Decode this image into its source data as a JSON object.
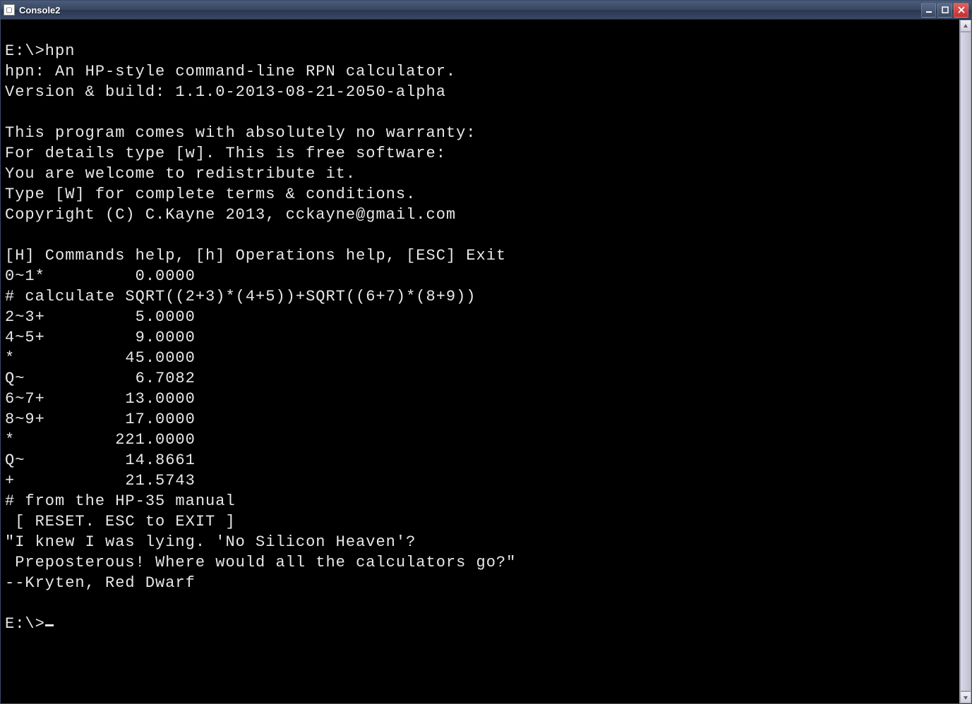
{
  "window": {
    "title": "Console2"
  },
  "terminal": {
    "lines": [
      "E:\\>hpn",
      "hpn: An HP-style command-line RPN calculator.",
      "Version & build: 1.1.0-2013-08-21-2050-alpha",
      "",
      "This program comes with absolutely no warranty:",
      "For details type [w]. This is free software:",
      "You are welcome to redistribute it.",
      "Type [W] for complete terms & conditions.",
      "Copyright (C) C.Kayne 2013, cckayne@gmail.com",
      "",
      "[H] Commands help, [h] Operations help, [ESC] Exit",
      "0~1*         0.0000",
      "# calculate SQRT((2+3)*(4+5))+SQRT((6+7)*(8+9))",
      "2~3+         5.0000",
      "4~5+         9.0000",
      "*           45.0000",
      "Q~           6.7082",
      "6~7+        13.0000",
      "8~9+        17.0000",
      "*          221.0000",
      "Q~          14.8661",
      "+           21.5743",
      "# from the HP-35 manual",
      " [ RESET. ESC to EXIT ]",
      "\"I knew I was lying. 'No Silicon Heaven'?",
      " Preposterous! Where would all the calculators go?\"",
      "--Kryten, Red Dwarf",
      "",
      "E:\\>"
    ]
  }
}
